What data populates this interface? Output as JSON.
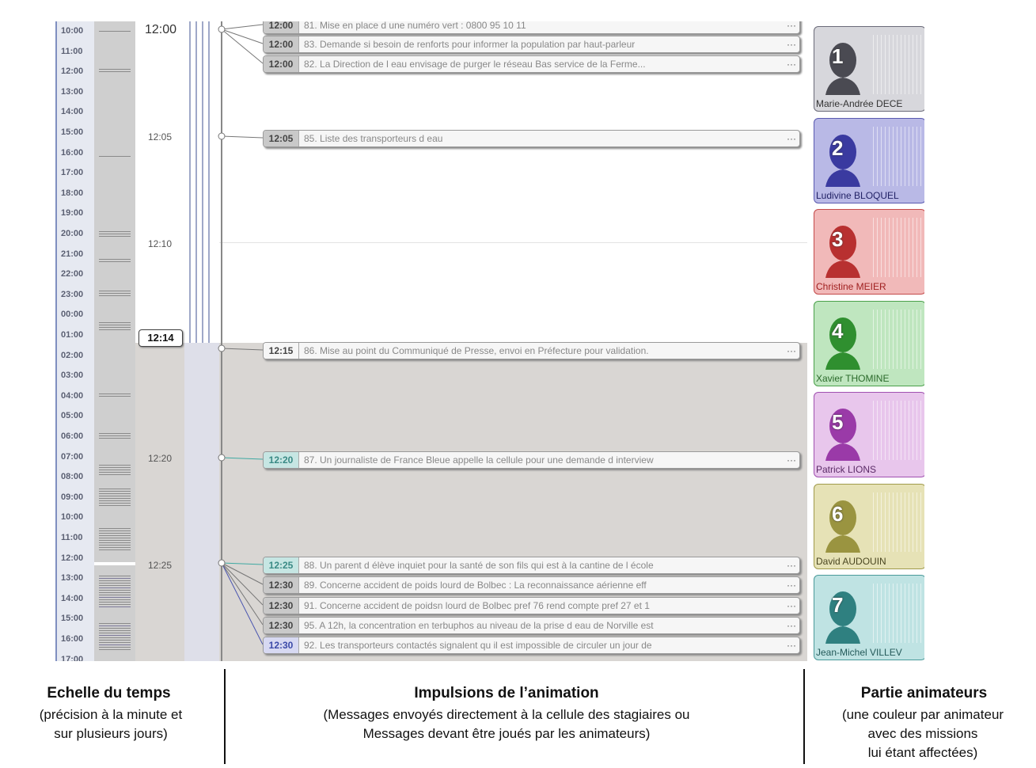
{
  "hours": [
    "10:00",
    "11:00",
    "12:00",
    "13:00",
    "14:00",
    "15:00",
    "16:00",
    "17:00",
    "18:00",
    "19:00",
    "20:00",
    "21:00",
    "22:00",
    "23:00",
    "00:00",
    "01:00",
    "02:00",
    "03:00",
    "04:00",
    "05:00",
    "06:00",
    "07:00",
    "08:00",
    "09:00",
    "10:00",
    "11:00",
    "12:00",
    "13:00",
    "14:00",
    "15:00",
    "16:00",
    "17:00"
  ],
  "minutes": {
    "m1200": "12:00",
    "m1205": "12:05",
    "m1210": "12:10",
    "m1220": "12:20",
    "m1225": "12:25"
  },
  "current_time": "12:14",
  "messages": [
    {
      "time": "12:00",
      "text": "81. Mise en place d une numéro vert : 0800 95 10 11",
      "style": "grey"
    },
    {
      "time": "12:00",
      "text": "83. Demande si besoin de renforts pour informer la population par haut-parleur",
      "style": "grey"
    },
    {
      "time": "12:00",
      "text": "82. La Direction de l eau envisage de purger le réseau Bas service de la Ferme...",
      "style": "grey"
    },
    {
      "time": "12:05",
      "text": "85. Liste des transporteurs d eau",
      "style": "grey"
    },
    {
      "time": "12:15",
      "text": "86. Mise au point du Communiqué de Presse, envoi en Préfecture pour validation.",
      "style": "plain"
    },
    {
      "time": "12:20",
      "text": "87. Un journaliste de France Bleue appelle la cellule pour une demande d interview",
      "style": "teal"
    },
    {
      "time": "12:25",
      "text": "88. Un parent d élève inquiet pour la santé de son fils qui est à la cantine de l école",
      "style": "teal"
    },
    {
      "time": "12:30",
      "text": "89. Concerne accident de poids lourd de Bolbec : La reconnaissance aérienne eff",
      "style": "grey"
    },
    {
      "time": "12:30",
      "text": "91. Concerne accident de poidsn lourd de Bolbec pref 76 rend compte pref 27 et 1",
      "style": "grey"
    },
    {
      "time": "12:30",
      "text": "95. A 12h, la concentration en terbuphos au niveau de la prise d eau de Norville est",
      "style": "grey"
    },
    {
      "time": "12:30",
      "text": "92. Les transporteurs contactés signalent qu il est impossible de circuler un jour de",
      "style": "blue"
    }
  ],
  "more_label": "···",
  "animators": [
    {
      "num": "1",
      "name": "Marie-Andrée DECE",
      "bg": "#d7d7dc",
      "border": "#6a6a78",
      "head": "#4a4a52",
      "text": "#333333"
    },
    {
      "num": "2",
      "name": "Ludivine BLOQUEL",
      "bg": "#b9b9e6",
      "border": "#5a5ab0",
      "head": "#3a3aa0",
      "text": "#222266"
    },
    {
      "num": "3",
      "name": "Christine MEIER",
      "bg": "#f1b9b9",
      "border": "#c44a4a",
      "head": "#b83030",
      "text": "#a02020"
    },
    {
      "num": "4",
      "name": "Xavier THOMINE",
      "bg": "#bfe6bf",
      "border": "#4aa04a",
      "head": "#2f8f2f",
      "text": "#2a6a2a"
    },
    {
      "num": "5",
      "name": "Patrick LIONS",
      "bg": "#e8c6ec",
      "border": "#a050b0",
      "head": "#9a3aa8",
      "text": "#5a2a66"
    },
    {
      "num": "6",
      "name": "David AUDOUIN",
      "bg": "#e6e2b6",
      "border": "#a09a4a",
      "head": "#9a9440",
      "text": "#4a4620"
    },
    {
      "num": "7",
      "name": "Jean-Michel VILLEV",
      "bg": "#bfe3e3",
      "border": "#4a9a9a",
      "head": "#2f8080",
      "text": "#245a5a"
    }
  ],
  "legend": {
    "time_title": "Echelle du temps",
    "time_line1": "(précision à la minute et",
    "time_line2": "sur plusieurs jours)",
    "impulse_title": "Impulsions de l’animation",
    "impulse_line1": "(Messages envoyés  directement à la cellule  des stagiaires ou",
    "impulse_line2": "Messages devant être joués par les animateurs)",
    "anim_title": "Partie animateurs",
    "anim_line1": "(une couleur par animateur",
    "anim_line2": "avec des missions",
    "anim_line3": "lui étant affectées)"
  }
}
